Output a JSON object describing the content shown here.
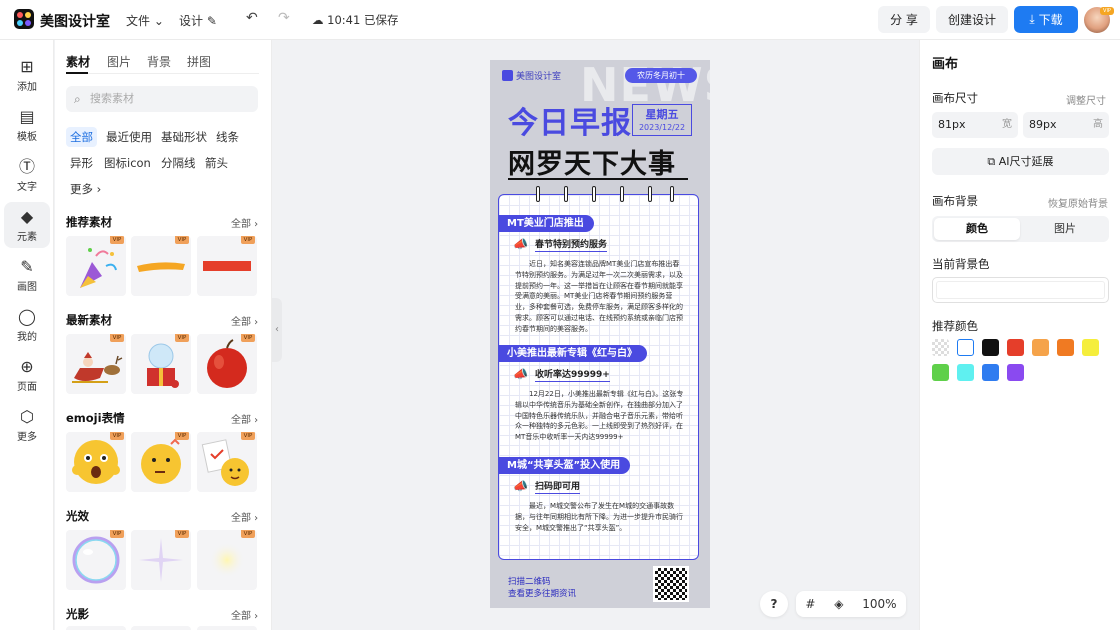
{
  "app": {
    "name": "美图设计室",
    "save_status": "10:41 已保存"
  },
  "topbar": {
    "menu_file": "文件",
    "menu_design": "设计",
    "share": "分 享",
    "create": "创建设计",
    "download": "下载",
    "avatar_badge": "VIP"
  },
  "rail": [
    {
      "label": "添加",
      "icon": "plus-square-icon"
    },
    {
      "label": "模板",
      "icon": "template-icon"
    },
    {
      "label": "文字",
      "icon": "text-icon"
    },
    {
      "label": "元素",
      "icon": "shapes-icon"
    },
    {
      "label": "画图",
      "icon": "pen-icon"
    },
    {
      "label": "我的",
      "icon": "user-icon"
    },
    {
      "label": "页面",
      "icon": "page-icon"
    },
    {
      "label": "更多",
      "icon": "box-icon"
    }
  ],
  "panel": {
    "tabs": [
      "素材",
      "图片",
      "背景",
      "拼图"
    ],
    "search_placeholder": "搜索素材",
    "chips": [
      "全部",
      "最近使用",
      "基础形状",
      "线条",
      "异形",
      "图标icon",
      "分隔线",
      "箭头",
      "更多"
    ],
    "sections": [
      {
        "title": "推荐素材",
        "all": "全部"
      },
      {
        "title": "最新素材",
        "all": "全部"
      },
      {
        "title": "emoji表情",
        "all": "全部"
      },
      {
        "title": "光效",
        "all": "全部"
      },
      {
        "title": "光影",
        "all": "全部"
      }
    ],
    "vip": "VIP"
  },
  "poster": {
    "brand": "美图设计室",
    "lunar": "农历冬月初十",
    "watermark": "NEWS",
    "title1": "今日早报",
    "weekday": "星期五",
    "date": "2023/12/22",
    "title2": "网罗天下大事",
    "items": [
      {
        "badge": "MT美业门店推出",
        "sub": "春节特别预约服务",
        "text": "近日，知名美容连锁品牌MT美业门店宣布推出春节特别预约服务。为满足过年一次二次美丽需求，以及提前预约一年。这一举措旨在让顾客在春节期间就能享受满意的美丽。MT美业门店将春节期间预约服务营业，多种套餐可选，免费停车服务，满足顾客多样化的需求。顾客可以通过电话、在线预约系统或亲临门店预约春节期间的美容服务。"
      },
      {
        "badge": "小美推出最新专辑《红与白》",
        "sub": "收听率达99999+",
        "text": "12月22日，小美推出最新专辑《红与白》。这张专辑以中华传统音乐为基础全新创作，在独曲部分加入了中国特色乐器传统乐队，并融合电子音乐元素，带给听众一种独特的多元色彩。一上线即受到了热烈好评，在MT音乐中收听率一天内达99999+"
      },
      {
        "badge": "M城“共享头盔”投入使用",
        "sub": "扫码即可用",
        "text": "最近，M城交警公布了发生在M城的交通事故数据，与往年同期相比有所下降。为进一步提升市民骑行安全，M城交警推出了“共享头盔”。"
      }
    ],
    "footer_line1": "扫描二维码",
    "footer_line2": "查看更多往期资讯"
  },
  "canvas_tools": {
    "help": "?",
    "zoom": "100%"
  },
  "right": {
    "title": "画布",
    "size_label": "画布尺寸",
    "size_adjust": "调整尺寸",
    "width_value": "81px",
    "width_unit": "宽",
    "height_value": "89px",
    "height_unit": "高",
    "ai_button": "AI尺寸延展",
    "bg_label": "画布背景",
    "bg_reset": "恢复原始背景",
    "seg_color": "颜色",
    "seg_image": "图片",
    "current_bg": "当前背景色",
    "recommend": "推荐颜色",
    "swatches": [
      "transparent",
      "#ffffff",
      "#111111",
      "#e53e2a",
      "#f5a34a",
      "#f07a22",
      "#f5ee3c",
      "#5fd04a",
      "#5ff0f0",
      "#2f7cf0",
      "#8a4af0"
    ]
  }
}
